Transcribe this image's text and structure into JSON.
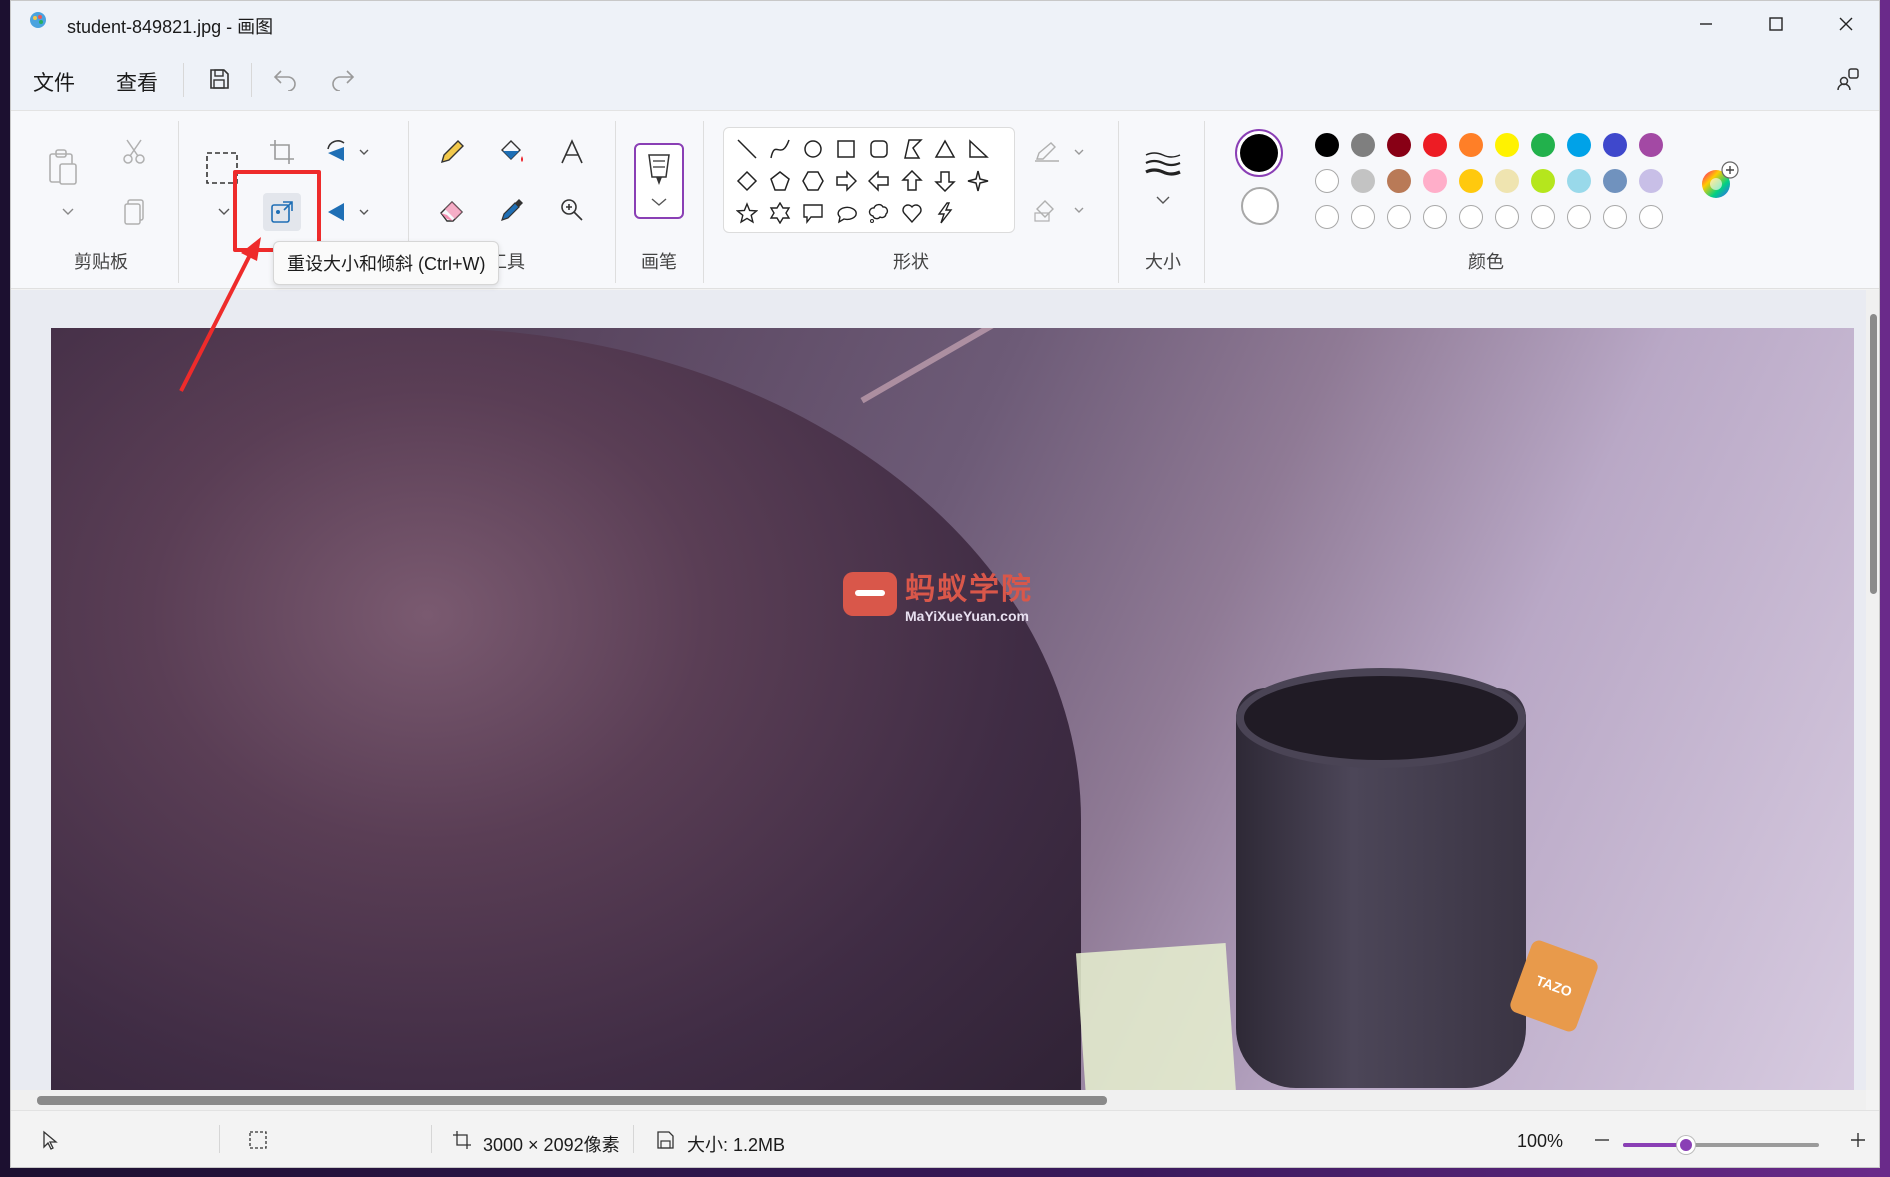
{
  "window": {
    "title": "student-849821.jpg - 画图",
    "controls": [
      "minimize-icon",
      "maximize-icon",
      "close-icon"
    ]
  },
  "menu": {
    "file": "文件",
    "view": "查看",
    "icons": [
      "save-icon",
      "undo-icon",
      "redo-icon",
      "account-icon"
    ]
  },
  "ribbon": {
    "groups": {
      "clipboard": "剪贴板",
      "tools": "工具",
      "brush": "画笔",
      "shapes": "形状",
      "size": "大小",
      "colors": "颜色"
    },
    "tooltip": "重设大小和倾斜 (Ctrl+W)",
    "palette_row1": [
      "#000000",
      "#7f7f7f",
      "#880015",
      "#ed1c24",
      "#ff7f27",
      "#fff200",
      "#22b14c",
      "#00a2e8",
      "#3f48cc",
      "#a349a4"
    ],
    "palette_row2": [
      "#ffffff",
      "#c3c3c3",
      "#b97a57",
      "#ffaec9",
      "#ffc90e",
      "#efe4b0",
      "#b5e61d",
      "#99d9ea",
      "#7092be",
      "#c8bfe7"
    ],
    "palette_row3_empty": 10,
    "primary_color": "#000000",
    "secondary_color": "#ffffff",
    "highlight_color": "#ee2b2b"
  },
  "canvas": {
    "watermark_title": "蚂蚁学院",
    "watermark_url": "MaYiXueYuan.com",
    "tag_text": "TAZO"
  },
  "status": {
    "dimensions": "3000 × 2092像素",
    "file_size": "大小: 1.2MB",
    "zoom": "100%",
    "zoom_level_fraction": 0.32
  }
}
